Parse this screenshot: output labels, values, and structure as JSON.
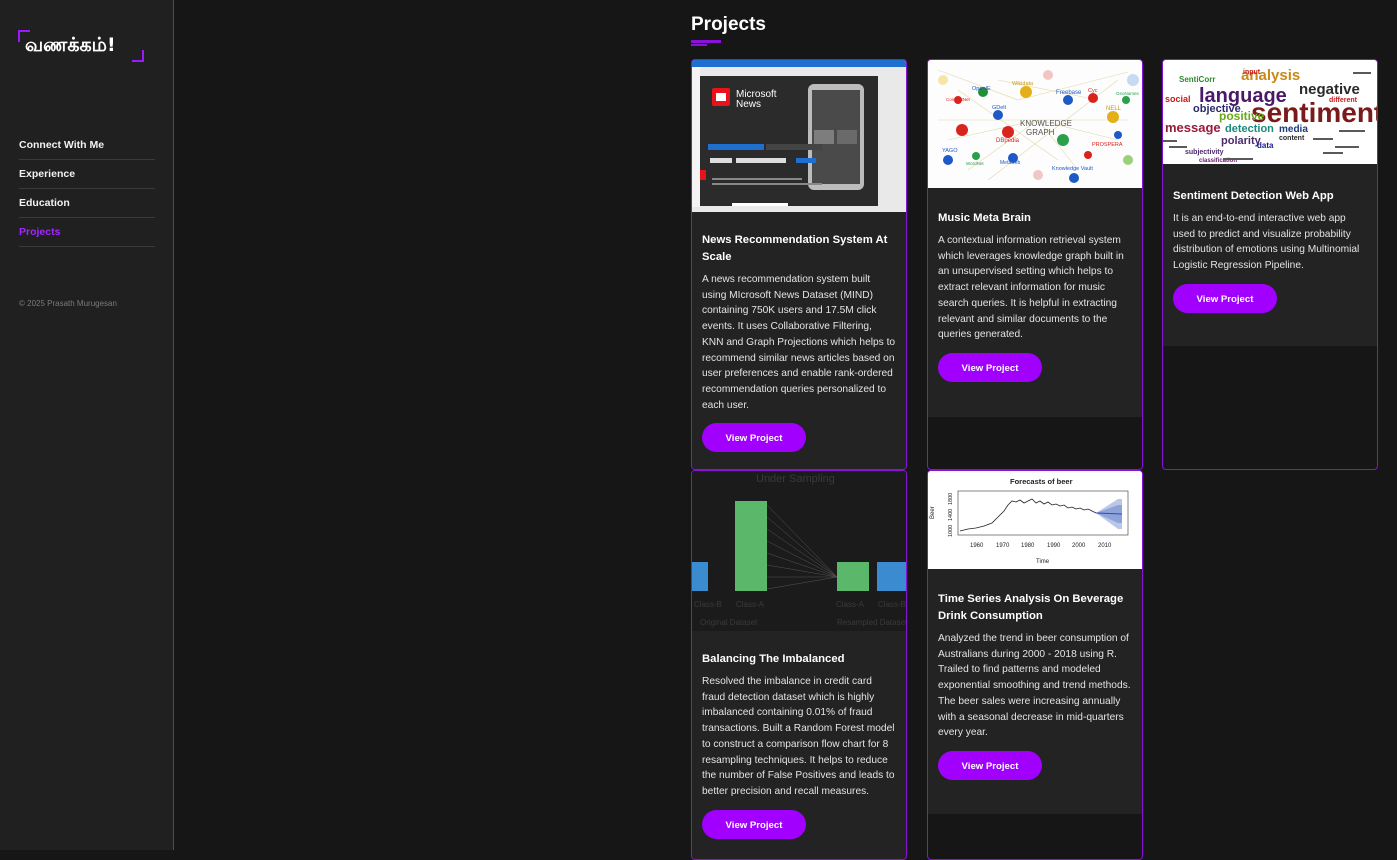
{
  "sidebar": {
    "logo_text": "வணக்கம்!",
    "nav": [
      {
        "label": "Connect With Me"
      },
      {
        "label": "Experience"
      },
      {
        "label": "Education"
      },
      {
        "label": "Projects",
        "active": true
      }
    ],
    "copyright": "© 2025 Prasath Murugesan"
  },
  "main": {
    "title": "Projects",
    "button_label": "View Project",
    "projects": [
      {
        "title": "News Recommendation System At Scale",
        "description": "A news recommendation system built using MIcrosoft News Dataset (MIND) containing 750K users and 17.5M click events. It uses Collaborative Filtering, KNN and Graph Projections which helps to recommend similar news articles based on user preferences and enable rank-ordered recommendation queries personalized to each user.",
        "thumb_text": {
          "brand_line1": "Microsoft",
          "brand_line2": "News"
        }
      },
      {
        "title": "Music Meta Brain",
        "description": "A contextual information retrieval system which leverages knowledge graph built in an unsupervised setting which helps to extract relevant information for music search queries. It is helpful in extracting relevant and similar documents to the queries generated.",
        "thumb_text": {
          "center_line1": "KNOWLEDGE",
          "center_line2": "GRAPH",
          "nodes": [
            "OpenIE",
            "Wikidata",
            "Freebase",
            "Cyc",
            "GeoNames",
            "ConceptNet",
            "GDelt",
            "NELL",
            "DBpedia",
            "YAGO",
            "PROSPERA",
            "Metaweb",
            "Knowledge Vault",
            "WordNet"
          ]
        }
      },
      {
        "title": "Sentiment Detection Web App",
        "description": "It is an end-to-end interactive web app used to predict and visualize probability distribution of emotions using Multinomial Logistic Regression Pipeline.",
        "thumb_text": {
          "words": [
            "sentiment",
            "language",
            "analysis",
            "negative",
            "message",
            "positive",
            "detection",
            "objective",
            "polarity",
            "subjectivity",
            "media",
            "social",
            "SentiCorr",
            "data",
            "input",
            "classification",
            "different",
            "content"
          ]
        }
      },
      {
        "title": "Balancing The Imbalanced",
        "description": "Resolved the imbalance in credit card fraud detection dataset which is highly imbalanced containing 0.01% of fraud transactions. Built a Random Forest model to construct a comparison flow chart for 8 resampling techniques. It helps to reduce the number of False Positives and leads to better precision and recall measures.",
        "thumb_text": {
          "chart_title": "Under Sampling",
          "label_b1": "Class-B",
          "label_a1": "Class-A",
          "label_a2": "Class-A",
          "label_b2": "Class-B",
          "caption_left": "Original Dataset",
          "caption_right": "Resampled Dataset"
        }
      },
      {
        "title": "Time Series Analysis On Beverage Drink Consumption",
        "description": "Analyzed the trend in beer consumption of Australians during 2000 - 2018 using R. Trailed to find patterns and modeled exponential smoothing and trend methods. The beer sales were increasing annually with a seasonal decrease in mid-quarters every year.",
        "thumb_text": {
          "chart_title": "Forecasts of beer",
          "ylabel": "Beer",
          "xlabel": "Time",
          "yticks": [
            "1000",
            "1400",
            "1800"
          ],
          "xticks": [
            "1960",
            "1970",
            "1980",
            "1990",
            "2000",
            "2010"
          ]
        }
      }
    ]
  }
}
